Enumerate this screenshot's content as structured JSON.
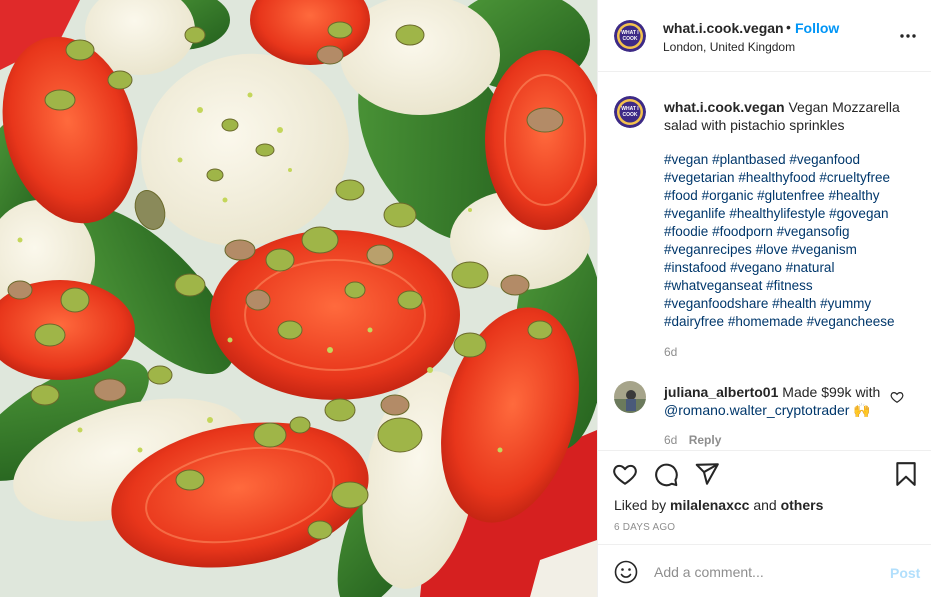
{
  "post": {
    "username": "what.i.cook.vegan",
    "follow_label": "Follow",
    "separator": "•",
    "location": "London, United Kingdom",
    "image_alt": "",
    "avatar_text_1": "WHAT I",
    "avatar_text_2": "COOK"
  },
  "caption": {
    "username": "what.i.cook.vegan",
    "text": "Vegan Mozzarella salad with pistachio sprinkles",
    "hashtags": [
      "#vegan",
      "#plantbased",
      "#veganfood",
      "#vegetarian",
      "#healthyfood",
      "#crueltyfree",
      "#food",
      "#organic",
      "#glutenfree",
      "#healthy",
      "#veganlife",
      "#healthylifestyle",
      "#govegan",
      "#foodie",
      "#foodporn",
      "#vegansofig",
      "#veganrecipes",
      "#love",
      "#veganism",
      "#instafood",
      "#vegano",
      "#natural",
      "#whatveganseat",
      "#fitness",
      "#veganfoodshare",
      "#health",
      "#yummy",
      "#dairyfree",
      "#homemade",
      "#vegancheese"
    ],
    "time": "6d"
  },
  "comment": {
    "username": "juliana_alberto01",
    "text": "Made $99k with",
    "mention": "@romano.walter_cryptotrader",
    "emoji": "🙌",
    "time": "6d",
    "reply_label": "Reply"
  },
  "engagement": {
    "liked_by_prefix": "Liked by",
    "liked_by_user": "milalenaxcc",
    "liked_by_and": "and",
    "liked_by_others": "others",
    "date": "6 DAYS AGO"
  },
  "composer": {
    "placeholder": "Add a comment...",
    "post_label": "Post"
  },
  "colors": {
    "accent": "#0095f6",
    "hashtag": "#00376b",
    "muted": "#8e8e8e",
    "post_disabled": "#b2dffc"
  },
  "icons": {
    "more": "more-horizontal-icon",
    "like": "heart-icon",
    "comment": "comment-icon",
    "share": "share-icon",
    "save": "bookmark-icon",
    "emoji": "emoji-icon"
  }
}
